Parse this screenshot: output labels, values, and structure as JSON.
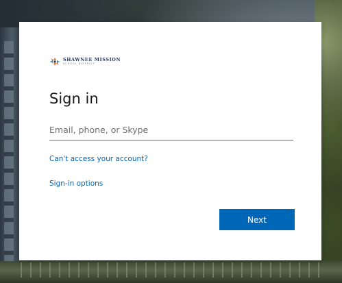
{
  "logo": {
    "line1": "SHAWNEE MISSION",
    "line2": "SCHOOL DISTRICT"
  },
  "signin": {
    "title": "Sign in",
    "email_placeholder": "Email, phone, or Skype",
    "email_value": "",
    "cant_access_link": "Can't access your account?",
    "options_link": "Sign-in options",
    "next_label": "Next"
  },
  "colors": {
    "accent": "#0067b8",
    "title_text": "#1b1b1b",
    "logo_navy": "#26375e",
    "logo_orange": "#e07b2a",
    "logo_teal": "#3a8fa6"
  }
}
